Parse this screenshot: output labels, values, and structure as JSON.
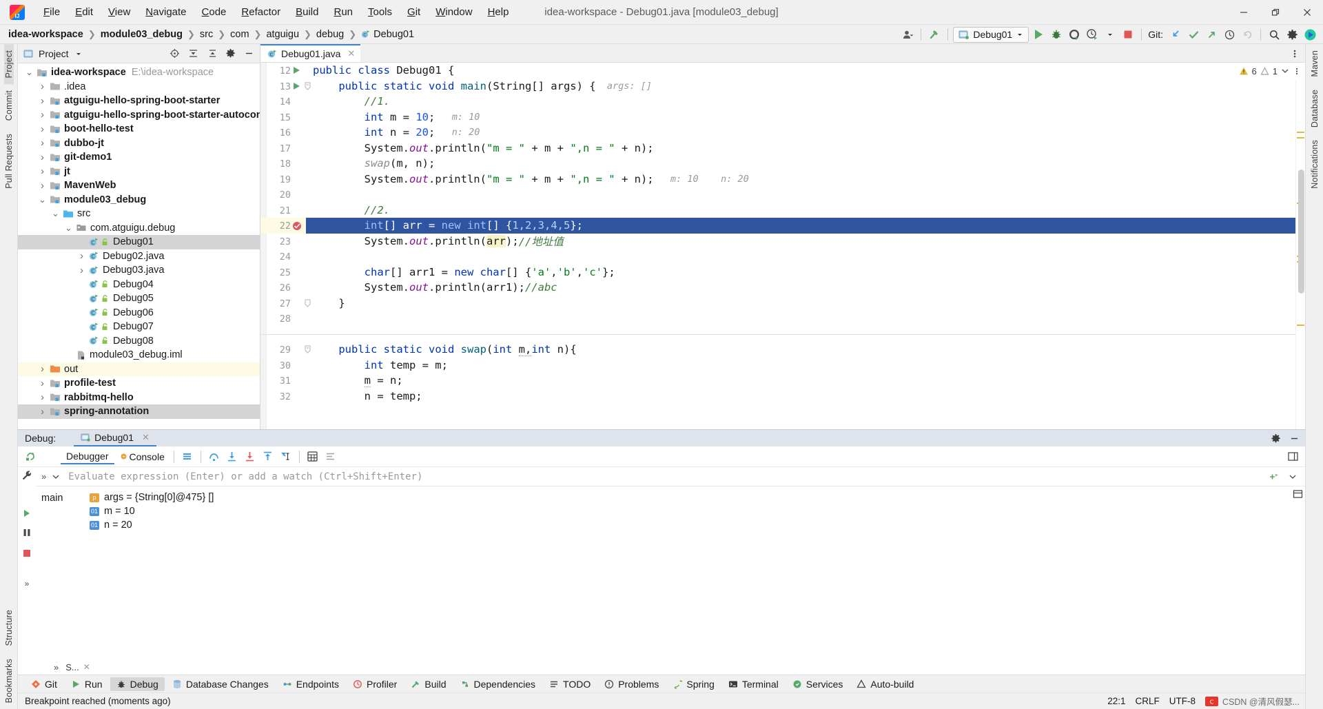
{
  "window": {
    "title": "idea-workspace - Debug01.java [module03_debug]",
    "menu": [
      "File",
      "Edit",
      "View",
      "Navigate",
      "Code",
      "Refactor",
      "Build",
      "Run",
      "Tools",
      "Git",
      "Window",
      "Help"
    ],
    "controls": {
      "minimize": "minimize-icon",
      "restore": "restore-icon",
      "close": "close-icon"
    }
  },
  "navbar": {
    "breadcrumbs": [
      "idea-workspace",
      "module03_debug",
      "src",
      "com",
      "atguigu",
      "debug",
      "Debug01"
    ],
    "run_config": "Debug01",
    "git_label": "Git:",
    "icons": [
      "account-icon",
      "build-hammer-icon",
      "run-icon",
      "debug-icon",
      "run-coverage-icon",
      "profiler-icon",
      "stop-icon",
      "git-update-icon",
      "git-commit-icon",
      "git-push-icon",
      "git-history-icon",
      "git-rollback-icon",
      "search-everywhere-icon",
      "settings-icon",
      "ide-assistant-icon"
    ]
  },
  "left_strip": {
    "top": [
      "Project",
      "Commit",
      "Pull Requests"
    ],
    "bottom": [
      "Structure",
      "Bookmarks"
    ]
  },
  "right_strip": {
    "items": [
      "Maven",
      "Database",
      "Notifications"
    ]
  },
  "project_panel": {
    "title": "Project",
    "header_icons": [
      "locate-icon",
      "collapse-all-icon",
      "expand-all-icon",
      "settings-icon",
      "hide-icon"
    ],
    "tree": [
      {
        "depth": 0,
        "arrow": "v",
        "icon": "module-folder-icon",
        "label": "idea-workspace",
        "bold": true,
        "path": "E:\\idea-workspace",
        "state": "normal"
      },
      {
        "depth": 1,
        "arrow": ">",
        "icon": "folder-icon",
        "label": ".idea",
        "bold": false,
        "path": "",
        "state": "normal"
      },
      {
        "depth": 1,
        "arrow": ">",
        "icon": "module-folder-icon",
        "label": "atguigu-hello-spring-boot-starter",
        "bold": true,
        "path": "",
        "state": "normal"
      },
      {
        "depth": 1,
        "arrow": ">",
        "icon": "module-folder-icon",
        "label": "atguigu-hello-spring-boot-starter-autoconfigu",
        "bold": true,
        "path": "",
        "state": "normal"
      },
      {
        "depth": 1,
        "arrow": ">",
        "icon": "module-folder-icon",
        "label": "boot-hello-test",
        "bold": true,
        "path": "",
        "state": "normal"
      },
      {
        "depth": 1,
        "arrow": ">",
        "icon": "module-folder-icon",
        "label": "dubbo-jt",
        "bold": true,
        "path": "",
        "state": "normal"
      },
      {
        "depth": 1,
        "arrow": ">",
        "icon": "module-folder-icon",
        "label": "git-demo1",
        "bold": true,
        "path": "",
        "state": "normal"
      },
      {
        "depth": 1,
        "arrow": ">",
        "icon": "module-folder-icon",
        "label": "jt",
        "bold": true,
        "path": "",
        "state": "normal"
      },
      {
        "depth": 1,
        "arrow": ">",
        "icon": "module-folder-icon",
        "label": "MavenWeb",
        "bold": true,
        "path": "",
        "state": "normal"
      },
      {
        "depth": 1,
        "arrow": "v",
        "icon": "module-folder-icon",
        "label": "module03_debug",
        "bold": true,
        "path": "",
        "state": "normal"
      },
      {
        "depth": 2,
        "arrow": "v",
        "icon": "source-folder-icon",
        "label": "src",
        "bold": false,
        "path": "",
        "state": "normal"
      },
      {
        "depth": 3,
        "arrow": "v",
        "icon": "package-icon",
        "label": "com.atguigu.debug",
        "bold": false,
        "path": "",
        "state": "normal"
      },
      {
        "depth": 4,
        "arrow": "",
        "icon": "java-class-icon",
        "label": "Debug01",
        "bold": false,
        "path": "",
        "state": "selected"
      },
      {
        "depth": 4,
        "arrow": ">",
        "icon": "java-file-icon",
        "label": "Debug02.java",
        "bold": false,
        "path": "",
        "state": "normal"
      },
      {
        "depth": 4,
        "arrow": ">",
        "icon": "java-file-icon",
        "label": "Debug03.java",
        "bold": false,
        "path": "",
        "state": "normal"
      },
      {
        "depth": 4,
        "arrow": "",
        "icon": "java-class-icon",
        "label": "Debug04",
        "bold": false,
        "path": "",
        "state": "normal"
      },
      {
        "depth": 4,
        "arrow": "",
        "icon": "java-class-icon",
        "label": "Debug05",
        "bold": false,
        "path": "",
        "state": "normal"
      },
      {
        "depth": 4,
        "arrow": "",
        "icon": "java-class-icon",
        "label": "Debug06",
        "bold": false,
        "path": "",
        "state": "normal"
      },
      {
        "depth": 4,
        "arrow": "",
        "icon": "java-class-icon",
        "label": "Debug07",
        "bold": false,
        "path": "",
        "state": "normal"
      },
      {
        "depth": 4,
        "arrow": "",
        "icon": "java-class-icon",
        "label": "Debug08",
        "bold": false,
        "path": "",
        "state": "normal"
      },
      {
        "depth": 3,
        "arrow": "",
        "icon": "iml-file-icon",
        "label": "module03_debug.iml",
        "bold": false,
        "path": "",
        "state": "normal"
      },
      {
        "depth": 1,
        "arrow": ">",
        "icon": "excluded-folder-icon",
        "label": "out",
        "bold": false,
        "path": "",
        "state": "highlighted"
      },
      {
        "depth": 1,
        "arrow": ">",
        "icon": "module-folder-icon",
        "label": "profile-test",
        "bold": true,
        "path": "",
        "state": "normal"
      },
      {
        "depth": 1,
        "arrow": ">",
        "icon": "module-folder-icon",
        "label": "rabbitmq-hello",
        "bold": true,
        "path": "",
        "state": "normal"
      },
      {
        "depth": 1,
        "arrow": ">",
        "icon": "module-folder-icon",
        "label": "spring-annotation",
        "bold": true,
        "path": "",
        "state": "partial"
      }
    ]
  },
  "editor": {
    "tab": {
      "label": "Debug01.java",
      "icon": "java-class-icon",
      "close": "close-icon"
    },
    "inspection": {
      "warnings": "6",
      "weak_warnings": "1",
      "warn_icon": "warning-triangle-icon",
      "weak_icon": "weak-warning-icon"
    },
    "lines": [
      {
        "num": "12",
        "run_marker": true,
        "fold": "",
        "tokens": [
          {
            "t": "public ",
            "c": "k"
          },
          {
            "t": "class ",
            "c": "k"
          },
          {
            "t": "Debug01 {",
            "c": ""
          }
        ]
      },
      {
        "num": "13",
        "run_marker": true,
        "fold": "minus",
        "tokens": [
          {
            "t": "    ",
            "c": ""
          },
          {
            "t": "public ",
            "c": "k"
          },
          {
            "t": "static ",
            "c": "k"
          },
          {
            "t": "void ",
            "c": "k"
          },
          {
            "t": "main",
            "c": "mth"
          },
          {
            "t": "(String[] args) {",
            "c": ""
          },
          {
            "t": "  args: []",
            "c": "hint"
          }
        ]
      },
      {
        "num": "14",
        "run_marker": false,
        "fold": "",
        "tokens": [
          {
            "t": "        ",
            "c": ""
          },
          {
            "t": "//1.",
            "c": "cmtg"
          }
        ]
      },
      {
        "num": "15",
        "run_marker": false,
        "fold": "",
        "tokens": [
          {
            "t": "        ",
            "c": ""
          },
          {
            "t": "int ",
            "c": "k"
          },
          {
            "t": "m = ",
            "c": ""
          },
          {
            "t": "10",
            "c": "num"
          },
          {
            "t": ";",
            "c": ""
          },
          {
            "t": "   m: 10",
            "c": "hint"
          }
        ]
      },
      {
        "num": "16",
        "run_marker": false,
        "fold": "",
        "tokens": [
          {
            "t": "        ",
            "c": ""
          },
          {
            "t": "int ",
            "c": "k"
          },
          {
            "t": "n = ",
            "c": ""
          },
          {
            "t": "20",
            "c": "num"
          },
          {
            "t": ";",
            "c": ""
          },
          {
            "t": "   n: 20",
            "c": "hint"
          }
        ]
      },
      {
        "num": "17",
        "run_marker": false,
        "fold": "",
        "tokens": [
          {
            "t": "        System.",
            "c": ""
          },
          {
            "t": "out",
            "c": "fld"
          },
          {
            "t": ".println(",
            "c": ""
          },
          {
            "t": "\"m = \"",
            "c": "str"
          },
          {
            "t": " + m + ",
            "c": ""
          },
          {
            "t": "\",n = \"",
            "c": "str"
          },
          {
            "t": " + n);",
            "c": ""
          }
        ]
      },
      {
        "num": "18",
        "run_marker": false,
        "fold": "",
        "tokens": [
          {
            "t": "        ",
            "c": ""
          },
          {
            "t": "swap",
            "c": "cmt"
          },
          {
            "t": "(m, n);",
            "c": ""
          }
        ]
      },
      {
        "num": "19",
        "run_marker": false,
        "fold": "",
        "tokens": [
          {
            "t": "        System.",
            "c": ""
          },
          {
            "t": "out",
            "c": "fld"
          },
          {
            "t": ".println(",
            "c": ""
          },
          {
            "t": "\"m = \"",
            "c": "str"
          },
          {
            "t": " + m + ",
            "c": ""
          },
          {
            "t": "\",n = \"",
            "c": "str"
          },
          {
            "t": " + n);",
            "c": ""
          },
          {
            "t": "   m: 10    n: 20",
            "c": "hint"
          }
        ]
      },
      {
        "num": "20",
        "run_marker": false,
        "fold": "",
        "tokens": []
      },
      {
        "num": "21",
        "run_marker": false,
        "fold": "",
        "tokens": [
          {
            "t": "        ",
            "c": ""
          },
          {
            "t": "//2.",
            "c": "cmtg"
          }
        ]
      },
      {
        "num": "22",
        "run_marker": false,
        "fold": "",
        "breakpoint": true,
        "current": true,
        "tokens": [
          {
            "t": "        ",
            "c": ""
          },
          {
            "t": "int",
            "c": "sel-k"
          },
          {
            "t": "[] arr = ",
            "c": "sel"
          },
          {
            "t": "new ",
            "c": "sel-k"
          },
          {
            "t": "int",
            "c": "sel-k"
          },
          {
            "t": "[] {",
            "c": "sel"
          },
          {
            "t": "1,2,3,4,5",
            "c": "sel-n"
          },
          {
            "t": "};",
            "c": "sel"
          }
        ]
      },
      {
        "num": "23",
        "run_marker": false,
        "fold": "",
        "tokens": [
          {
            "t": "        System.",
            "c": ""
          },
          {
            "t": "out",
            "c": "fld"
          },
          {
            "t": ".println(",
            "c": ""
          },
          {
            "t": "arr",
            "c": "mark"
          },
          {
            "t": ");",
            "c": ""
          },
          {
            "t": "//地址值",
            "c": "cmtg"
          }
        ]
      },
      {
        "num": "24",
        "run_marker": false,
        "fold": "",
        "tokens": []
      },
      {
        "num": "25",
        "run_marker": false,
        "fold": "",
        "tokens": [
          {
            "t": "        ",
            "c": ""
          },
          {
            "t": "char",
            "c": "k"
          },
          {
            "t": "[] arr1 = ",
            "c": ""
          },
          {
            "t": "new ",
            "c": "k"
          },
          {
            "t": "char",
            "c": "k"
          },
          {
            "t": "[] {",
            "c": ""
          },
          {
            "t": "'a'",
            "c": "str"
          },
          {
            "t": ",",
            "c": ""
          },
          {
            "t": "'b'",
            "c": "str"
          },
          {
            "t": ",",
            "c": ""
          },
          {
            "t": "'c'",
            "c": "str"
          },
          {
            "t": "};",
            "c": ""
          }
        ]
      },
      {
        "num": "26",
        "run_marker": false,
        "fold": "",
        "tokens": [
          {
            "t": "        System.",
            "c": ""
          },
          {
            "t": "out",
            "c": "fld"
          },
          {
            "t": ".println(arr1);",
            "c": ""
          },
          {
            "t": "//abc",
            "c": "cmtg"
          }
        ]
      },
      {
        "num": "27",
        "run_marker": false,
        "fold": "end",
        "tokens": [
          {
            "t": "    }",
            "c": ""
          }
        ]
      },
      {
        "num": "28",
        "run_marker": false,
        "fold": "",
        "tokens": []
      },
      {
        "num": "",
        "run_marker": false,
        "fold": "",
        "separator": true,
        "tokens": []
      },
      {
        "num": "29",
        "run_marker": false,
        "fold": "minus",
        "tokens": [
          {
            "t": "    ",
            "c": ""
          },
          {
            "t": "public ",
            "c": "k"
          },
          {
            "t": "static ",
            "c": "k"
          },
          {
            "t": "void ",
            "c": "k"
          },
          {
            "t": "swap",
            "c": "mth"
          },
          {
            "t": "(",
            "c": ""
          },
          {
            "t": "int ",
            "c": "k"
          },
          {
            "t": "m,",
            "c": "u"
          },
          {
            "t": "int ",
            "c": "k"
          },
          {
            "t": "n){",
            "c": ""
          }
        ]
      },
      {
        "num": "30",
        "run_marker": false,
        "fold": "",
        "tokens": [
          {
            "t": "        ",
            "c": ""
          },
          {
            "t": "int ",
            "c": "k"
          },
          {
            "t": "temp = m;",
            "c": ""
          }
        ]
      },
      {
        "num": "31",
        "run_marker": false,
        "fold": "",
        "tokens": [
          {
            "t": "        ",
            "c": ""
          },
          {
            "t": "m",
            "c": "u"
          },
          {
            "t": " = n;",
            "c": ""
          }
        ]
      },
      {
        "num": "32",
        "run_marker": false,
        "fold": "",
        "tokens": [
          {
            "t": "        n = temp;",
            "c": ""
          }
        ]
      }
    ]
  },
  "debug": {
    "header_label": "Debug:",
    "session_tab": "Debug01",
    "session_close": "close-icon",
    "header_icons": [
      "settings-icon",
      "hide-icon"
    ],
    "tabs": [
      "Debugger",
      "Console"
    ],
    "active_tab": "Debugger",
    "toolbar_icons": [
      "rerun-icon",
      "mute-breakpoints-icon",
      "step-over-icon",
      "step-into-icon",
      "force-step-into-icon",
      "step-out-icon",
      "run-to-cursor-icon",
      "evaluate-icon",
      "settings-list-icon",
      "layout-icon"
    ],
    "left_icons": [
      "resume-icon",
      "pause-icon",
      "stop-icon"
    ],
    "eval_placeholder": "Evaluate expression (Enter) or add a watch (Ctrl+Shift+Enter)",
    "eval_value": "",
    "eval_icons": [
      "expand-icon",
      "chevron-down-icon",
      "add-watch-icon",
      "collapse-icon"
    ],
    "frame": "main",
    "variables": [
      {
        "badge": "p",
        "badge_color": "#e8a33d",
        "text": "args = {String[0]@475} []"
      },
      {
        "badge": "01",
        "badge_color": "#4a90d9",
        "text": "m = 10"
      },
      {
        "badge": "01",
        "badge_color": "#4a90d9",
        "text": "n = 20"
      }
    ],
    "bottom_tab": "S...",
    "bottom_tab_close": "close-icon"
  },
  "bottom_bar": {
    "items": [
      {
        "label": "Git",
        "icon": "git-icon",
        "active": false
      },
      {
        "label": "Run",
        "icon": "run-icon",
        "active": false
      },
      {
        "label": "Debug",
        "icon": "debug-icon",
        "active": true
      },
      {
        "label": "Database Changes",
        "icon": "database-icon",
        "active": false
      },
      {
        "label": "Endpoints",
        "icon": "endpoints-icon",
        "active": false
      },
      {
        "label": "Profiler",
        "icon": "profiler-icon",
        "active": false
      },
      {
        "label": "Build",
        "icon": "build-icon",
        "active": false
      },
      {
        "label": "Dependencies",
        "icon": "dependencies-icon",
        "active": false
      },
      {
        "label": "TODO",
        "icon": "todo-icon",
        "active": false
      },
      {
        "label": "Problems",
        "icon": "problems-icon",
        "active": false
      },
      {
        "label": "Spring",
        "icon": "spring-icon",
        "active": false
      },
      {
        "label": "Terminal",
        "icon": "terminal-icon",
        "active": false
      },
      {
        "label": "Services",
        "icon": "services-icon",
        "active": false
      },
      {
        "label": "Auto-build",
        "icon": "autobuild-icon",
        "active": false
      }
    ]
  },
  "status_bar": {
    "message": "Breakpoint reached (moments ago)",
    "caret": "22:1",
    "line_separator": "CRLF",
    "encoding": "UTF-8",
    "watermark": "CSDN @清风假瑟..."
  }
}
